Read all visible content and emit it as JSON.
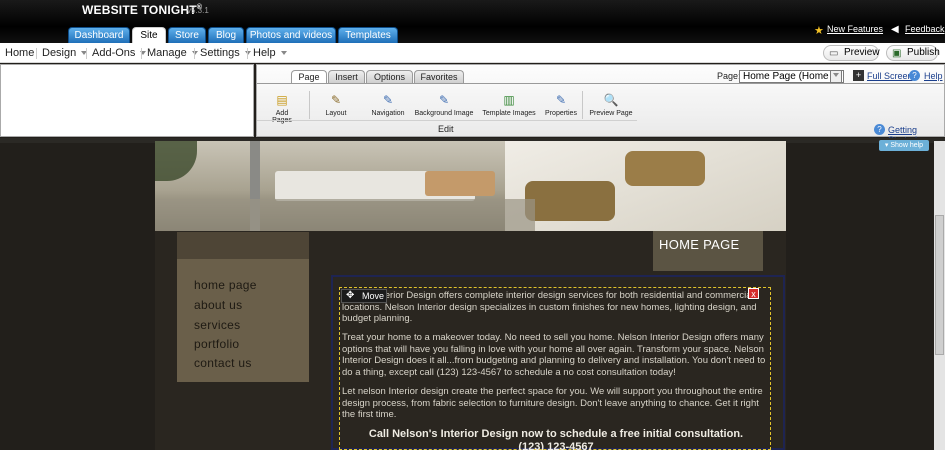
{
  "app": {
    "brand": "WEBSITE TONIGHT",
    "brand_mark": "®",
    "version": "v5.3.1"
  },
  "tabs": [
    {
      "label": "Dashboard",
      "active": false
    },
    {
      "label": "Site",
      "active": true
    },
    {
      "label": "Store",
      "active": false
    },
    {
      "label": "Blog",
      "active": false
    },
    {
      "label": "Photos and videos",
      "active": false
    },
    {
      "label": "Templates",
      "active": false
    }
  ],
  "toplinks": {
    "new_features": "New Features",
    "feedback": "Feedback"
  },
  "menubar": {
    "items": [
      "Home",
      "Design",
      "Add-Ons",
      "Manage",
      "Settings",
      "Help"
    ],
    "preview": "Preview",
    "publish": "Publish"
  },
  "ribbon": {
    "tabs": [
      "Page",
      "Insert",
      "Options",
      "Favorites"
    ],
    "active_tab": "Page",
    "tools": [
      "Add Pages",
      "Layout",
      "Navigation",
      "Background Image",
      "Template Images",
      "Properties",
      "Preview Page"
    ],
    "group_label": "Edit",
    "page_label": "Page:",
    "page_value": "Home Page (Home I",
    "full_screen": "Full Screen",
    "help": "Help",
    "getting_started": "Getting Started"
  },
  "show_help": "Show help",
  "site": {
    "nav": [
      "home page",
      "about us",
      "services",
      "portfolio",
      "contact us"
    ],
    "heading": "HOME PAGE",
    "move_label": "Move",
    "close_label": "x",
    "paragraphs": [
      "Nelson Interior Design offers complete interior design services for both residential and commercial locations. Nelson Interior design specializes in custom finishes for new homes, lighting design, and budget planning.",
      "Treat your home to a makeover today. No need to sell you home. Nelson Interior Design offers many options that will have you falling in love with your home all over again. Transform your space. Nelson Interior Design does it all...from budgeting and planning to delivery and installation. You don't need to do a thing, except call (123) 123-4567 to schedule a no cost consultation today!",
      "Let nelson Interior design create the perfect space for you. We will support you throughout the entire design process, from fabric selection to furniture design. Don't leave anything to chance. Get it right the first time."
    ],
    "cta_line1": "Call Nelson's Interior Design now to schedule a free initial consultation.",
    "cta_line2": "(123) 123-4567"
  },
  "colors": {
    "tab_blue": "#1f6fb8",
    "accent_yellow": "#e2c42b",
    "site_dark": "#2a2620",
    "nav_panel": "#6a5f4a"
  }
}
